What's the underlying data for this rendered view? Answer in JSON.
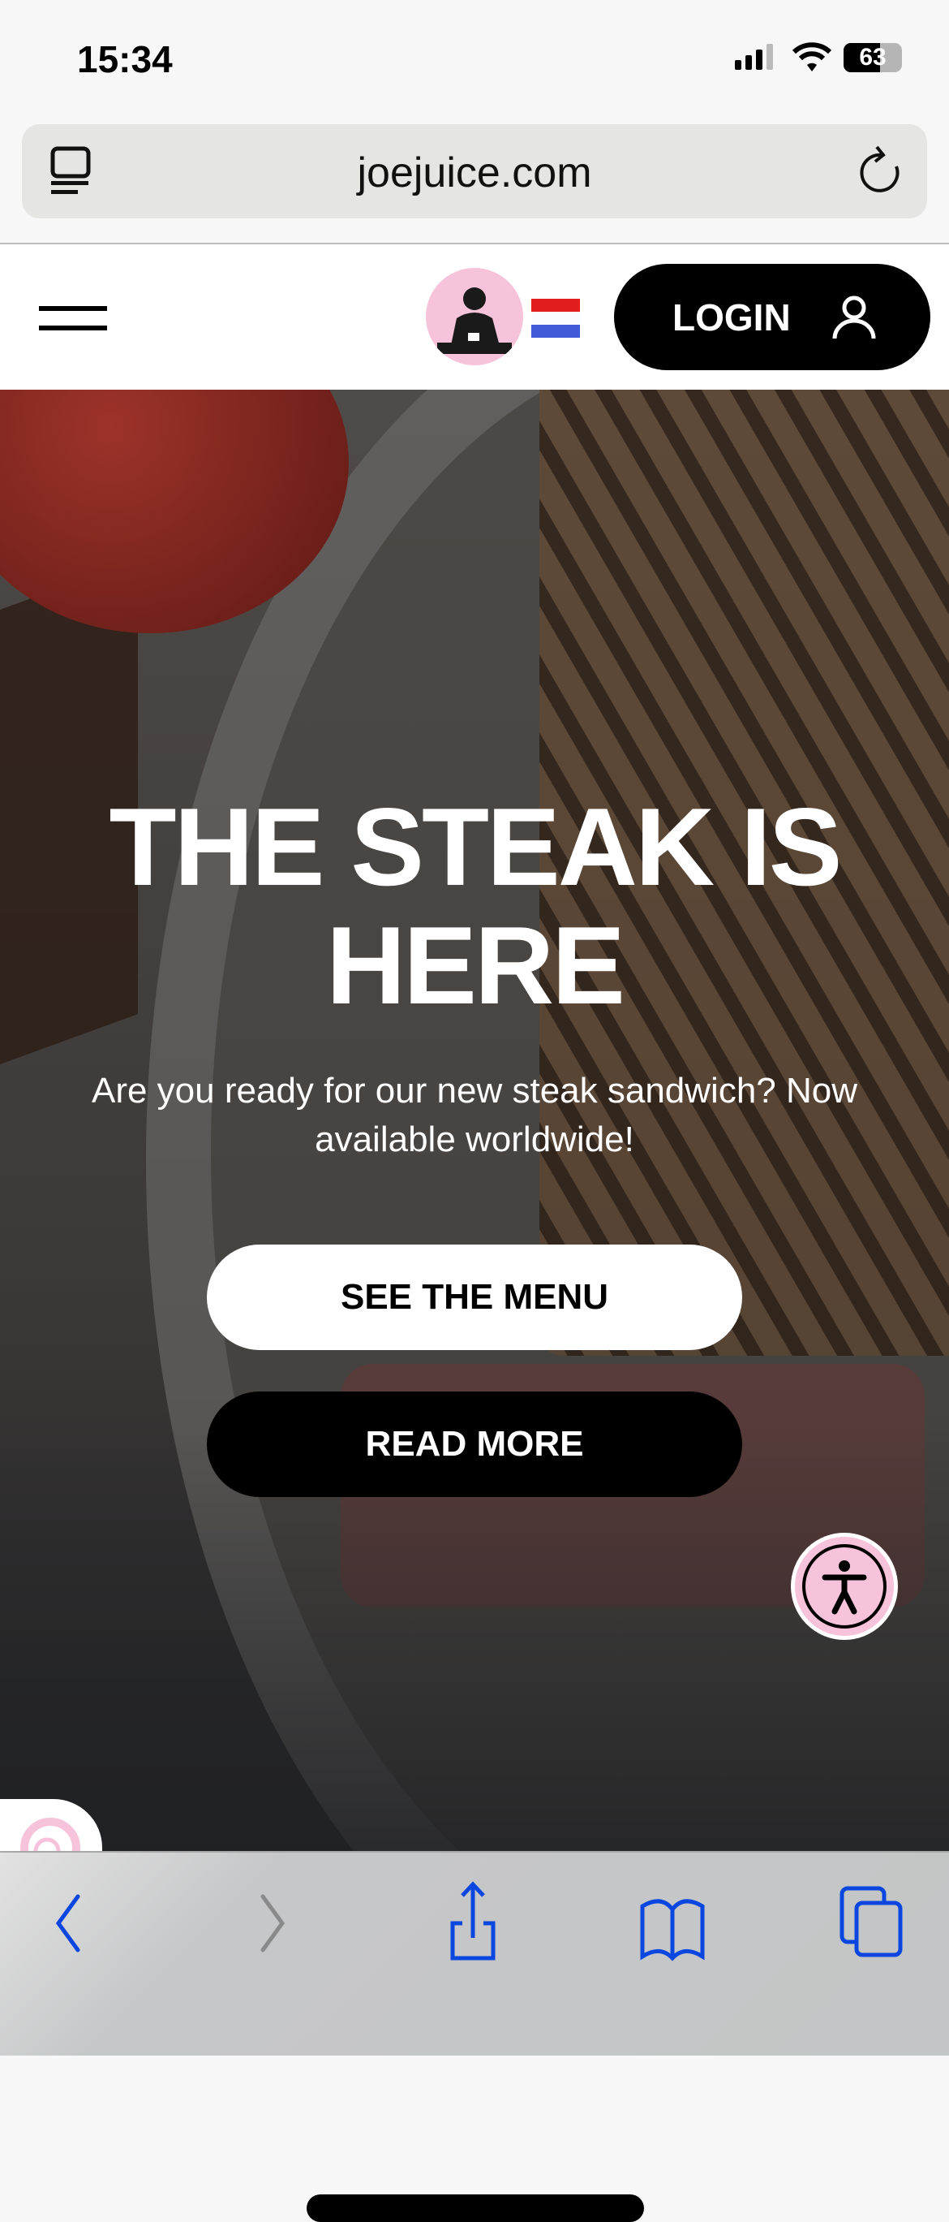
{
  "status_bar": {
    "time": "15:34",
    "battery": "63",
    "battery_level": 63
  },
  "browser": {
    "url": "joejuice.com"
  },
  "site_nav": {
    "login_label": "LOGIN",
    "flag_colors": [
      "#e21d1d",
      "#f8fbff",
      "#3f5bd8"
    ],
    "logo_bg": "#f6c3db"
  },
  "hero": {
    "headline": "THE STEAK IS HERE",
    "subtitle": "Are you ready for our new steak sandwich? Now available worldwide!",
    "primary_button": "SEE THE MENU",
    "secondary_button": "READ MORE"
  },
  "toolbar": {
    "accent": "#0a46e0",
    "icons": [
      "back-icon",
      "forward-icon",
      "share-icon",
      "bookmarks-icon",
      "tabs-icon"
    ]
  }
}
